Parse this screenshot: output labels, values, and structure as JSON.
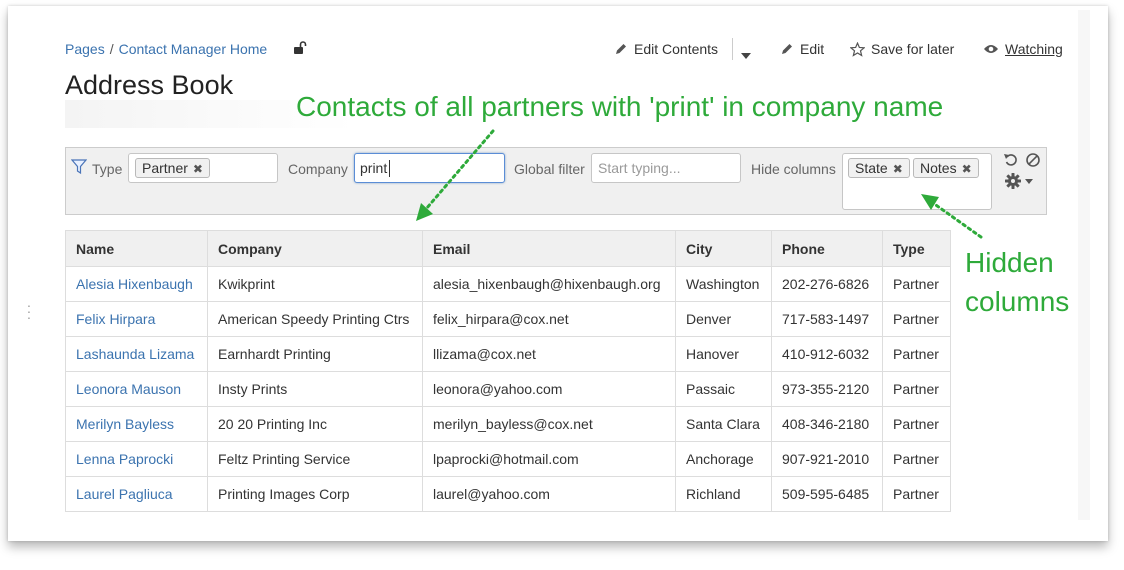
{
  "breadcrumb": {
    "pages": "Pages",
    "separator": "/",
    "current": "Contact Manager Home"
  },
  "actions": {
    "edit_contents": "Edit Contents",
    "edit": "Edit",
    "save_for_later": "Save for later",
    "watching": "Watching"
  },
  "title": "Address Book",
  "annotations": {
    "top": "Contacts of all partners with 'print' in company name",
    "right_line1": "Hidden",
    "right_line2": "columns"
  },
  "filters": {
    "type_label": "Type",
    "type_tag": "Partner",
    "company_label": "Company",
    "company_value": "print",
    "global_label": "Global filter",
    "global_placeholder": "Start typing...",
    "hide_label": "Hide columns",
    "hide_tags": [
      "State",
      "Notes"
    ]
  },
  "table": {
    "headers": [
      "Name",
      "Company",
      "Email",
      "City",
      "Phone",
      "Type"
    ],
    "rows": [
      [
        "Alesia Hixenbaugh",
        "Kwikprint",
        "alesia_hixenbaugh@hixenbaugh.org",
        "Washington",
        "202-276-6826",
        "Partner"
      ],
      [
        "Felix Hirpara",
        "American Speedy Printing Ctrs",
        "felix_hirpara@cox.net",
        "Denver",
        "717-583-1497",
        "Partner"
      ],
      [
        "Lashaunda Lizama",
        "Earnhardt Printing",
        "llizama@cox.net",
        "Hanover",
        "410-912-6032",
        "Partner"
      ],
      [
        "Leonora Mauson",
        "Insty Prints",
        "leonora@yahoo.com",
        "Passaic",
        "973-355-2120",
        "Partner"
      ],
      [
        "Merilyn Bayless",
        "20 20 Printing Inc",
        "merilyn_bayless@cox.net",
        "Santa Clara",
        "408-346-2180",
        "Partner"
      ],
      [
        "Lenna Paprocki",
        "Feltz Printing Service",
        "lpaprocki@hotmail.com",
        "Anchorage",
        "907-921-2010",
        "Partner"
      ],
      [
        "Laurel Pagliuca",
        "Printing Images Corp",
        "laurel@yahoo.com",
        "Richland",
        "509-595-6485",
        "Partner"
      ]
    ]
  },
  "colors": {
    "link": "#3b73af",
    "annotation": "#2eaa3a"
  }
}
